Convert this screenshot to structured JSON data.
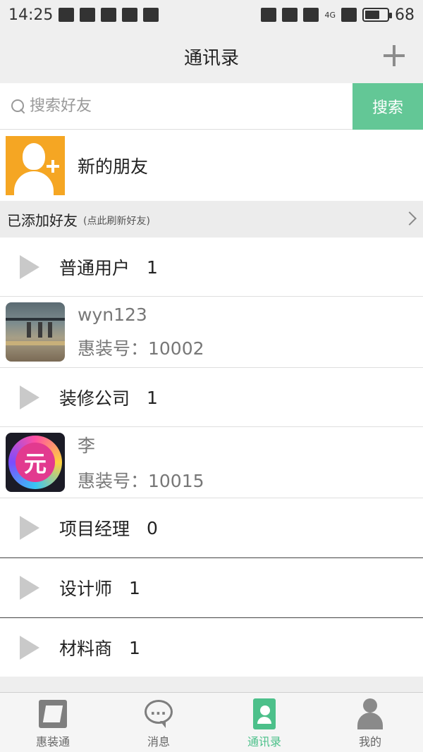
{
  "status_bar": {
    "time": "14:25",
    "battery": "68",
    "network_label": "4G"
  },
  "header": {
    "title": "通讯录"
  },
  "search": {
    "placeholder": "搜索好友",
    "value": "",
    "button_label": "搜索"
  },
  "new_friends": {
    "label": "新的朋友"
  },
  "section": {
    "title": "已添加好友",
    "hint": "(点此刷新好友)"
  },
  "groups": [
    {
      "label": "普通用户",
      "count": "1"
    },
    {
      "label": "装修公司",
      "count": "1"
    },
    {
      "label": "项目经理",
      "count": "0"
    },
    {
      "label": "设计师",
      "count": "1"
    },
    {
      "label": "材料商",
      "count": "1"
    }
  ],
  "contacts": [
    {
      "name": "wyn123",
      "id_text": "惠装号：10002"
    },
    {
      "name": "李",
      "id_text": "惠装号：10015"
    }
  ],
  "avatar_text": {
    "yuan": "元"
  },
  "bottom_nav": [
    {
      "label": "惠装通",
      "icon": "home-icon",
      "active": false
    },
    {
      "label": "消息",
      "icon": "message-icon",
      "active": false
    },
    {
      "label": "通讯录",
      "icon": "contacts-icon",
      "active": true
    },
    {
      "label": "我的",
      "icon": "profile-icon",
      "active": false
    }
  ],
  "colors": {
    "accent": "#63c796",
    "new_friends_avatar": "#f5a623",
    "header_bg": "#efefef"
  }
}
